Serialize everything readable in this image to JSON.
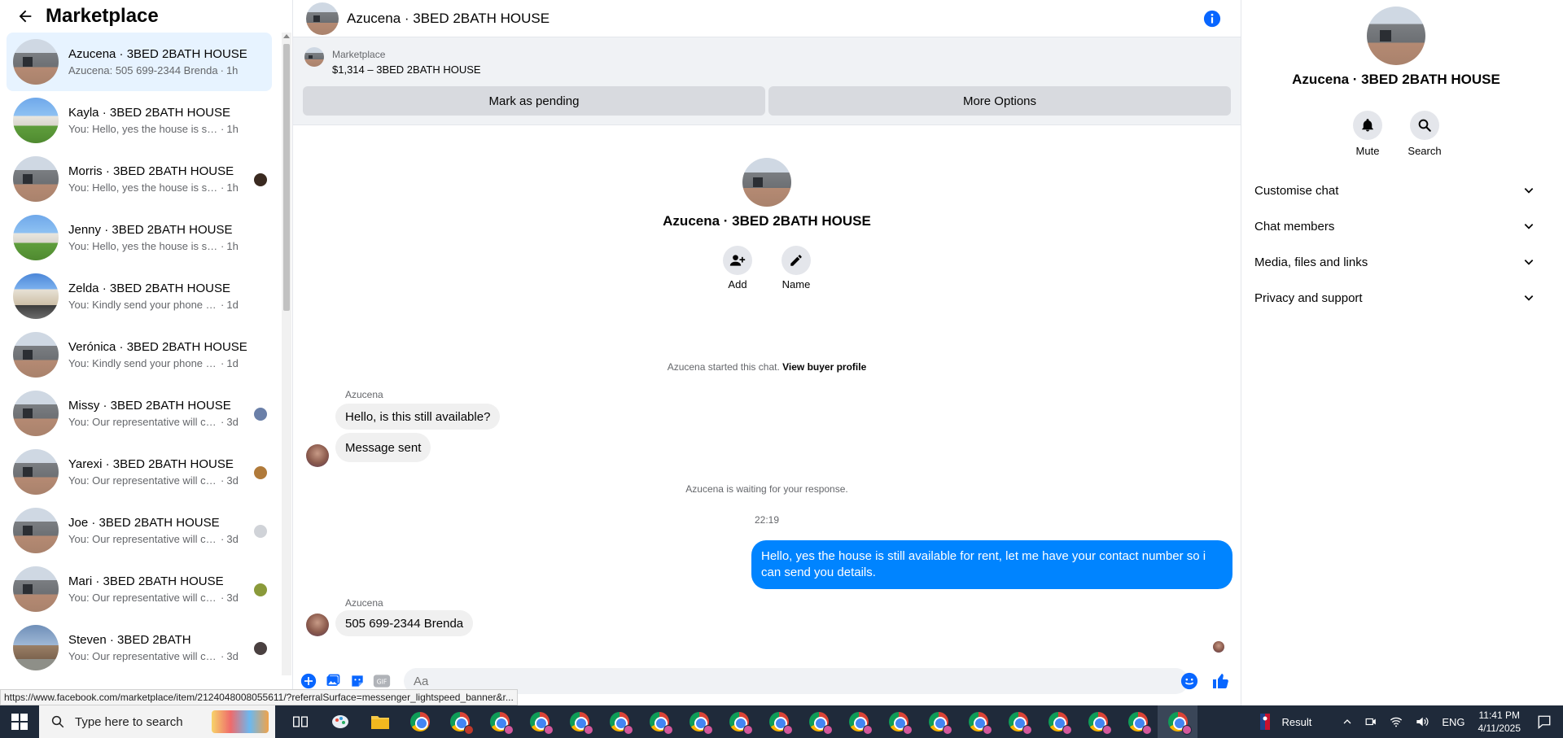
{
  "left_panel": {
    "title": "Marketplace",
    "conversations": [
      {
        "name": "Azucena · 3BED 2BATH HOUSE",
        "snippet": "Azucena: 505 699-2344 Brenda",
        "time": "1h",
        "thumb": "modern",
        "active": true
      },
      {
        "name": "Kayla · 3BED 2BATH HOUSE",
        "snippet": "You: Hello, yes the house is still ava...",
        "time": "1h",
        "thumb": "green"
      },
      {
        "name": "Morris · 3BED 2BATH HOUSE",
        "snippet": "You: Hello, yes the house is still ...",
        "time": "1h",
        "thumb": "modern",
        "receipt": "#3a2a20"
      },
      {
        "name": "Jenny · 3BED 2BATH HOUSE",
        "snippet": "You: Hello, yes the house is still ava...",
        "time": "1h",
        "thumb": "green"
      },
      {
        "name": "Zelda · 3BED 2BATH HOUSE",
        "snippet": "You: Kindly send your phone if you...",
        "time": "1d",
        "thumb": "garage"
      },
      {
        "name": "Verónica · 3BED 2BATH HOUSE",
        "snippet": "You: Kindly send your phone if you...",
        "time": "1d",
        "thumb": "modern"
      },
      {
        "name": "Missy · 3BED 2BATH HOUSE",
        "snippet": "You: Our representative will con...",
        "time": "3d",
        "thumb": "modern",
        "receipt": "#6a7fa8"
      },
      {
        "name": "Yarexi · 3BED 2BATH HOUSE",
        "snippet": "You: Our representative will con...",
        "time": "3d",
        "thumb": "modern",
        "receipt": "#b07a3a"
      },
      {
        "name": "Joe · 3BED 2BATH HOUSE",
        "snippet": "You: Our representative will con...",
        "time": "3d",
        "thumb": "modern",
        "receipt": "#d0d3d8"
      },
      {
        "name": "Mari · 3BED 2BATH HOUSE",
        "snippet": "You: Our representative will con...",
        "time": "3d",
        "thumb": "modern",
        "receipt": "#8a9a3a"
      },
      {
        "name": "Steven · 3BED 2BATH",
        "snippet": "You: Our representative will con...",
        "time": "3d",
        "thumb": "brick",
        "receipt": "#4a4040"
      }
    ]
  },
  "header": {
    "title": "Azucena · 3BED 2BATH HOUSE"
  },
  "listing": {
    "source": "Marketplace",
    "price_title": "$1,314 – 3BED 2BATH HOUSE",
    "mark_pending": "Mark as pending",
    "more_options": "More Options"
  },
  "chat_intro": {
    "name": "Azucena · 3BED 2BATH HOUSE",
    "add_label": "Add",
    "name_label": "Name",
    "started_text": "Azucena started this chat.",
    "view_profile": "View buyer profile"
  },
  "messages": {
    "sender1": "Azucena",
    "msg1": "Hello, is this still available?",
    "msg2": "Message sent",
    "waiting": "Azucena is waiting for your response.",
    "time": "22:19",
    "out1": "Hello, yes the house is still available for rent, let me have your contact number so i can send you details.",
    "sender2": "Azucena",
    "msg3": "505 699-2344 Brenda"
  },
  "composer": {
    "placeholder": "Aa"
  },
  "right_panel": {
    "name": "Azucena · 3BED 2BATH HOUSE",
    "mute": "Mute",
    "search": "Search",
    "sections": [
      "Customise chat",
      "Chat members",
      "Media, files and links",
      "Privacy and support"
    ]
  },
  "status_url": "https://www.facebook.com/marketplace/item/2124048008055611/?referralSurface=messenger_lightspeed_banner&r...",
  "taskbar": {
    "search_placeholder": "Type here to search",
    "tray_result": "Result",
    "lang": "ENG",
    "time": "11:41 PM",
    "date": "4/11/2025"
  },
  "colors": {
    "accent": "#0084ff",
    "active_row": "#e7f3ff",
    "taskbar": "#1f2a3a"
  }
}
